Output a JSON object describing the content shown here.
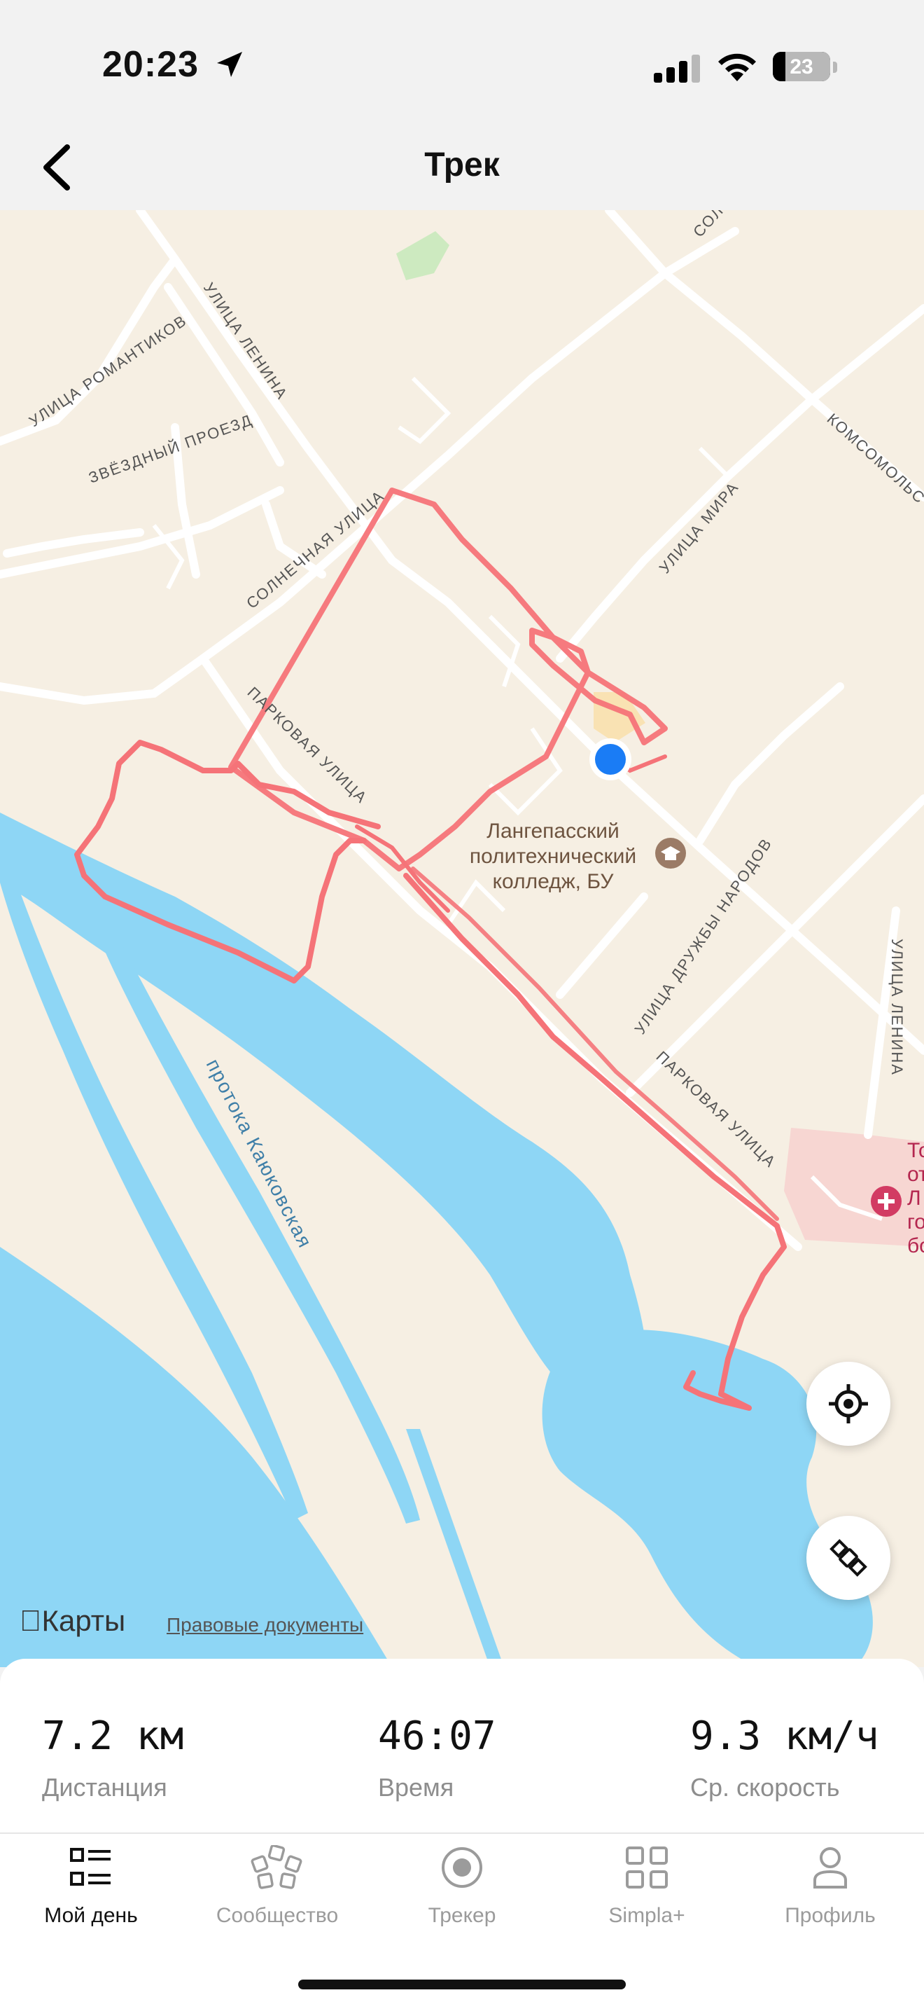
{
  "status_bar": {
    "time": "20:23",
    "battery": "23"
  },
  "header": {
    "title": "Трек"
  },
  "map": {
    "streets": {
      "romantikov": "УЛИЦА РОМАНТИКОВ",
      "lenina_top": "УЛИЦА ЛЕНИНА",
      "zvezdny": "ЗВЁЗДНЫЙ ПРОЕЗД",
      "solnechnaya": "СОЛНЕЧНАЯ УЛИЦА",
      "mira": "УЛИЦА МИРА",
      "komsomolskaya": "КОМСОМОЛЬС",
      "sol_top": "СОЛ",
      "parkovaya_1": "ПАРКОВАЯ УЛИЦА",
      "parkovaya_2": "ПАРКОВАЯ УЛИЦА",
      "druzhby": "УЛИЦА ДРУЖБЫ НАРОДОВ",
      "lenina_right": "УЛИЦА ЛЕНИНА",
      "protoka": "протока Каюковская"
    },
    "poi": {
      "college_line1": "Лангепасский",
      "college_line2": "политехнический",
      "college_line3": "колледж, БУ",
      "hospital": [
        "То",
        "от",
        "Л",
        "го",
        "бо"
      ]
    },
    "attribution": "Карты",
    "legal_link": "Правовые документы",
    "colors": {
      "land": "#f6efe3",
      "water": "#8ed6f5",
      "track": "#f57378",
      "road": "#ffffff",
      "location": "#1a7cf5"
    }
  },
  "stats": {
    "distance": {
      "value": "7.2 км",
      "label": "Дистанция"
    },
    "time": {
      "value": "46:07",
      "label": "Время"
    },
    "speed": {
      "value": "9.3 км/ч",
      "label": "Ср. скорость"
    }
  },
  "tabs": [
    {
      "label": "Мой день",
      "icon": "list-icon",
      "active": true
    },
    {
      "label": "Сообщество",
      "icon": "community-icon",
      "active": false
    },
    {
      "label": "Трекер",
      "icon": "tracker-icon",
      "active": false
    },
    {
      "label": "Simpla+",
      "icon": "grid-icon",
      "active": false
    },
    {
      "label": "Профиль",
      "icon": "profile-icon",
      "active": false
    }
  ]
}
